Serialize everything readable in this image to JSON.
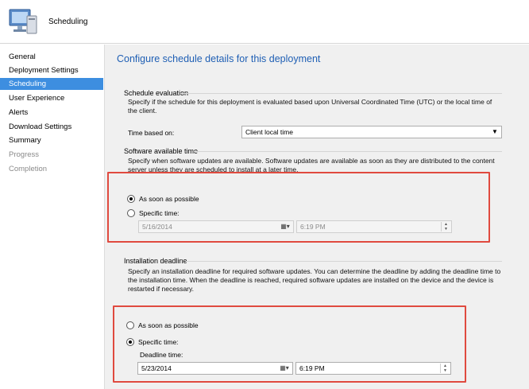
{
  "header": {
    "title": "Scheduling",
    "icon": "computer-monitor-icon"
  },
  "sidebar": {
    "items": [
      {
        "label": "General",
        "state": "normal"
      },
      {
        "label": "Deployment Settings",
        "state": "normal"
      },
      {
        "label": "Scheduling",
        "state": "active"
      },
      {
        "label": "User Experience",
        "state": "normal"
      },
      {
        "label": "Alerts",
        "state": "normal"
      },
      {
        "label": "Download Settings",
        "state": "normal"
      },
      {
        "label": "Summary",
        "state": "normal"
      },
      {
        "label": "Progress",
        "state": "disabled"
      },
      {
        "label": "Completion",
        "state": "disabled"
      }
    ],
    "active_color": "#3d8ee0"
  },
  "main": {
    "title": "Configure schedule details for this deployment",
    "schedule_evaluation": {
      "heading": "Schedule evaluation",
      "description": "Specify if the schedule for this deployment is evaluated based upon Universal Coordinated Time (UTC) or the local time of the client.",
      "time_based_label": "Time based on:",
      "time_based_value": "Client local time"
    },
    "available_time": {
      "heading": "Software available time",
      "description": "Specify when software updates are available. Software updates are available as soon as they are distributed to the content server unless they are scheduled to install at a later time.",
      "asap_label": "As soon as possible",
      "specific_label": "Specific time:",
      "selected": "asap",
      "date": "5/16/2014",
      "time": "6:19 PM"
    },
    "deadline": {
      "heading": "Installation deadline",
      "description": "Specify an installation deadline for required software updates. You can determine the deadline by adding the deadline time to the installation time. When the deadline is reached, required software updates are installed on the device and the device is restarted if necessary.",
      "asap_label": "As soon as possible",
      "specific_label": "Specific time:",
      "selected": "specific",
      "deadline_time_label": "Deadline time:",
      "date": "5/23/2014",
      "time": "6:19 PM"
    },
    "highlight_color": "#e04a3f"
  }
}
